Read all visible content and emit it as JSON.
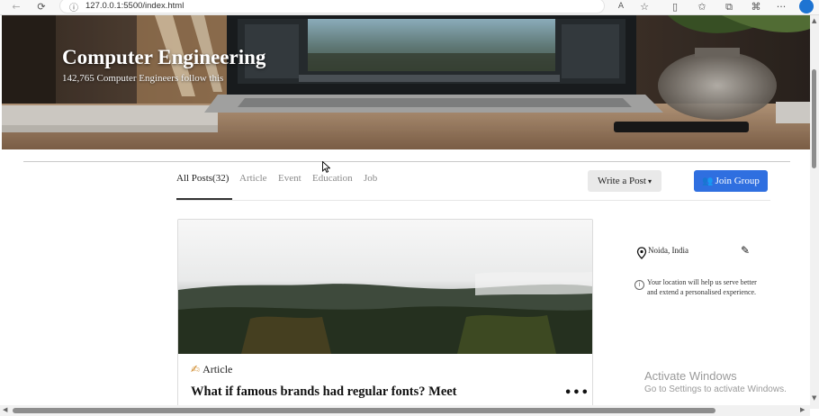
{
  "browser": {
    "url": "127.0.0.1:5500/index.html",
    "back_icon": "←",
    "refresh_icon": "⟳",
    "info_icon": "ⓘ",
    "read_aloud_icon": "A",
    "favorite_icon": "☆",
    "split_icon": "▯",
    "favorites_bar_icon": "✩",
    "collections_icon": "⧉",
    "extensions_icon": "⌘",
    "menu_icon": "···"
  },
  "hero": {
    "title": "Computer Engineering",
    "subtitle": "142,765 Computer Engineers follow this"
  },
  "tabs": {
    "all": "All Posts(32)",
    "article": "Article",
    "event": "Event",
    "education": "Education",
    "job": "Job"
  },
  "actions": {
    "write_post": "Write a Post",
    "write_caret": "▾",
    "join_group": "Join Group",
    "join_icon": "👥"
  },
  "post": {
    "type_icon": "✍",
    "type_label": "Article",
    "title": "What if famous brands had regular fonts? Meet",
    "more": "•••"
  },
  "location": {
    "place": "Noida, India",
    "edit_icon": "✎",
    "info_glyph": "i",
    "note": "Your location will help us serve better and extend a personalised experience."
  },
  "watermark": {
    "line1": "Activate Windows",
    "line2": "Go to Settings to activate Windows."
  },
  "scrollbar": {
    "up": "▲",
    "down": "▼",
    "left": "◀",
    "right": "▶"
  }
}
